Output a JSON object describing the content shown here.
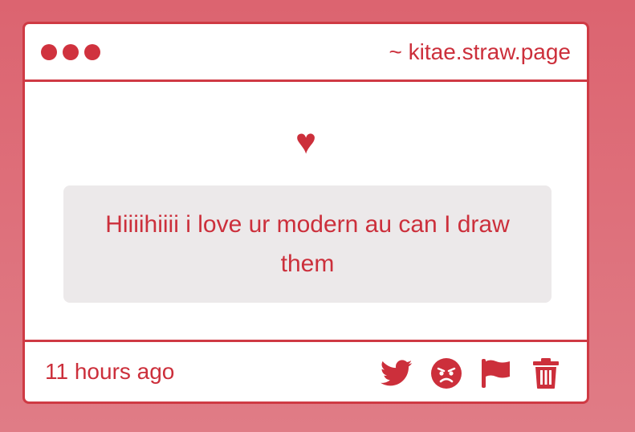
{
  "window": {
    "url": "~ kitae.straw.page"
  },
  "message": {
    "heart_icon": "heart-icon",
    "text": "Hiiiihiiii i love ur modern au can I draw them"
  },
  "footer": {
    "time": "11 hours ago",
    "actions": [
      {
        "icon": "twitter-icon"
      },
      {
        "icon": "angry-face-icon"
      },
      {
        "icon": "flag-icon"
      },
      {
        "icon": "trash-icon"
      }
    ]
  },
  "colors": {
    "accent": "#cc2f3b",
    "background": "#dc6470",
    "message_bg": "#ece9ea"
  }
}
